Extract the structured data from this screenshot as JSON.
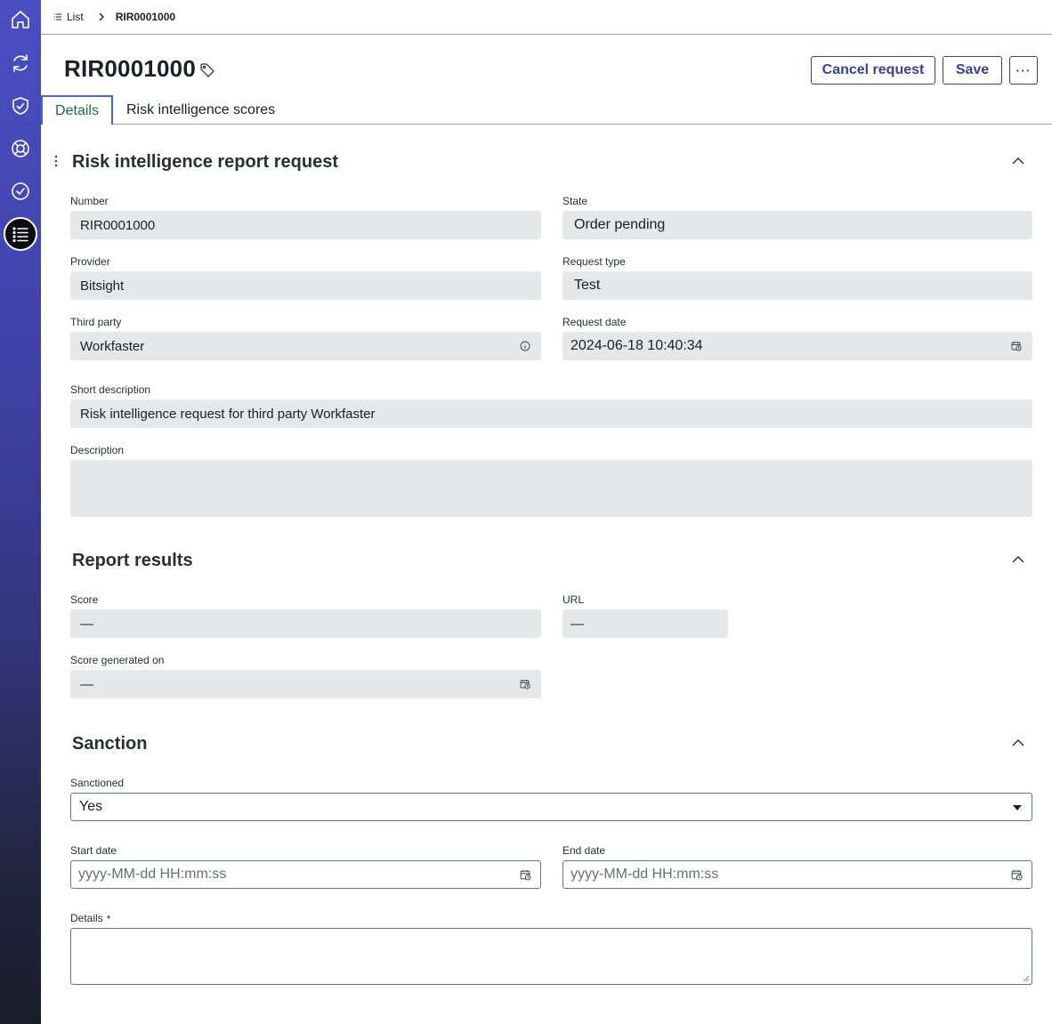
{
  "rail": {
    "items": [
      {
        "name": "home-icon"
      },
      {
        "name": "refresh-icon"
      },
      {
        "name": "shield-check-icon"
      },
      {
        "name": "lifebuoy-icon"
      },
      {
        "name": "check-circle-icon"
      },
      {
        "name": "list-icon",
        "active": true
      }
    ]
  },
  "breadcrumb": {
    "list_label": "List",
    "current": "RIR0001000"
  },
  "header": {
    "title": "RIR0001000",
    "cancel_label": "Cancel request",
    "save_label": "Save",
    "more_label": "···"
  },
  "tabs": [
    {
      "label": "Details",
      "active": true
    },
    {
      "label": "Risk intelligence scores",
      "active": false
    }
  ],
  "sections": {
    "request": {
      "title": "Risk intelligence report request",
      "fields": {
        "number": {
          "label": "Number",
          "value": "RIR0001000"
        },
        "state": {
          "label": "State",
          "value": "Order pending"
        },
        "provider": {
          "label": "Provider",
          "value": "Bitsight"
        },
        "request_type": {
          "label": "Request type",
          "value": "Test"
        },
        "third_party": {
          "label": "Third party",
          "value": "Workfaster"
        },
        "request_date": {
          "label": "Request date",
          "value": "2024-06-18 10:40:34"
        },
        "short_description": {
          "label": "Short description",
          "value": "Risk intelligence request for third party Workfaster"
        },
        "description": {
          "label": "Description",
          "value": ""
        }
      }
    },
    "results": {
      "title": "Report results",
      "fields": {
        "score": {
          "label": "Score",
          "value": "—"
        },
        "url": {
          "label": "URL",
          "value": "—"
        },
        "score_generated_on": {
          "label": "Score generated on",
          "value": "—"
        }
      }
    },
    "sanction": {
      "title": "Sanction",
      "fields": {
        "sanctioned": {
          "label": "Sanctioned",
          "value": "Yes"
        },
        "start_date": {
          "label": "Start date",
          "placeholder": "yyyy-MM-dd HH:mm:ss"
        },
        "end_date": {
          "label": "End date",
          "placeholder": "yyyy-MM-dd HH:mm:ss"
        },
        "details": {
          "label": "Details",
          "required_marker": "*"
        }
      }
    }
  },
  "colors": {
    "rail_top": "#4a4ec2",
    "rail_bottom": "#1b1c2a",
    "accent": "#3c3f9c",
    "field_bg": "#e6e7ea",
    "active_tab_text": "#1f6b3f",
    "active_tab_border": "#3d6bd6"
  }
}
